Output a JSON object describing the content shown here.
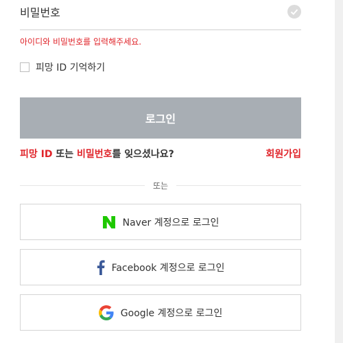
{
  "password_field": {
    "placeholder": "비밀번호"
  },
  "error_message": "아이디와 비밀번호를 입력해주세요.",
  "remember": {
    "label": "피망 ID 기억하기"
  },
  "login_button": {
    "label": "로그인"
  },
  "forgot": {
    "part1": "피망 ID",
    "part2": " 또는 ",
    "part3": "비밀번호",
    "part4": "를 잊으셨나요?"
  },
  "signup_link": "회원가입",
  "divider_text": "또는",
  "social": {
    "naver_label": "Naver 계정으로 로그인",
    "facebook_label": "Facebook 계정으로 로그인",
    "google_label": "Google 계정으로 로그인"
  },
  "colors": {
    "accent_red": "#e0242a",
    "login_button_bg": "#a8aeb4",
    "naver_green": "#1ec800",
    "facebook_blue": "#3b5998"
  },
  "icons": [
    "check-icon",
    "naver-icon",
    "facebook-icon",
    "google-icon"
  ]
}
